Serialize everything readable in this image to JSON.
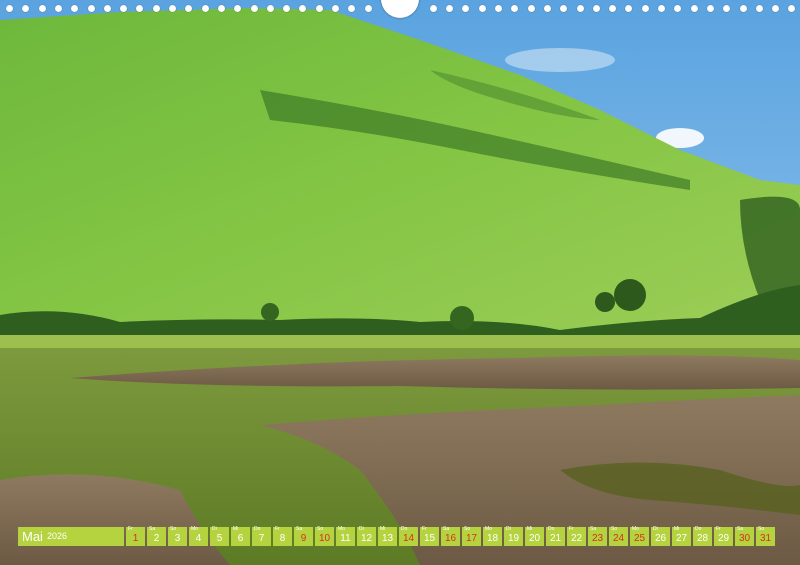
{
  "calendar": {
    "month": "Mai",
    "year": "2026",
    "days": [
      {
        "num": "1",
        "wd": "Fr",
        "red": true
      },
      {
        "num": "2",
        "wd": "Sa",
        "red": false
      },
      {
        "num": "3",
        "wd": "So",
        "red": false
      },
      {
        "num": "4",
        "wd": "Mo",
        "red": false
      },
      {
        "num": "5",
        "wd": "Di",
        "red": false
      },
      {
        "num": "6",
        "wd": "Mi",
        "red": false
      },
      {
        "num": "7",
        "wd": "Do",
        "red": false
      },
      {
        "num": "8",
        "wd": "Fr",
        "red": false
      },
      {
        "num": "9",
        "wd": "Sa",
        "red": true
      },
      {
        "num": "10",
        "wd": "So",
        "red": true
      },
      {
        "num": "11",
        "wd": "Mo",
        "red": false
      },
      {
        "num": "12",
        "wd": "Di",
        "red": false
      },
      {
        "num": "13",
        "wd": "Mi",
        "red": false
      },
      {
        "num": "14",
        "wd": "Do",
        "red": true
      },
      {
        "num": "15",
        "wd": "Fr",
        "red": false
      },
      {
        "num": "16",
        "wd": "Sa",
        "red": true
      },
      {
        "num": "17",
        "wd": "So",
        "red": true
      },
      {
        "num": "18",
        "wd": "Mo",
        "red": false
      },
      {
        "num": "19",
        "wd": "Di",
        "red": false
      },
      {
        "num": "20",
        "wd": "Mi",
        "red": false
      },
      {
        "num": "21",
        "wd": "Do",
        "red": false
      },
      {
        "num": "22",
        "wd": "Fr",
        "red": false
      },
      {
        "num": "23",
        "wd": "Sa",
        "red": true
      },
      {
        "num": "24",
        "wd": "So",
        "red": true
      },
      {
        "num": "25",
        "wd": "Mo",
        "red": true
      },
      {
        "num": "26",
        "wd": "Di",
        "red": false
      },
      {
        "num": "27",
        "wd": "Mi",
        "red": false
      },
      {
        "num": "28",
        "wd": "Do",
        "red": false
      },
      {
        "num": "29",
        "wd": "Fr",
        "red": false
      },
      {
        "num": "30",
        "wd": "Sa",
        "red": true
      },
      {
        "num": "31",
        "wd": "So",
        "red": true
      }
    ]
  },
  "colors": {
    "strip": "#b5d33f",
    "highlight_text": "#d4321e"
  }
}
